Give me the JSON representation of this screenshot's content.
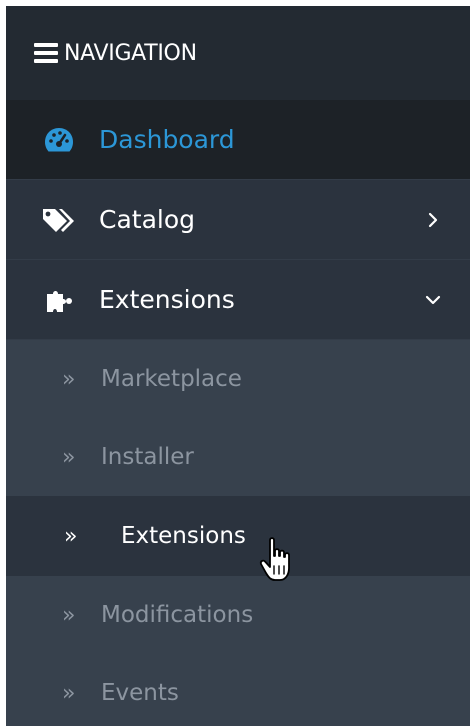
{
  "header": {
    "title": "NAVIGATION"
  },
  "menu": [
    {
      "label": "Dashboard",
      "icon": "dashboard-icon",
      "active": true
    },
    {
      "label": "Catalog",
      "icon": "tags-icon",
      "expanded": false
    },
    {
      "label": "Extensions",
      "icon": "puzzle-icon",
      "expanded": true
    }
  ],
  "submenu": [
    {
      "label": "Marketplace",
      "glyph": "»"
    },
    {
      "label": "Installer",
      "glyph": "»"
    },
    {
      "label": "Extensions",
      "glyph": "»",
      "active": true
    },
    {
      "label": "Modifications",
      "glyph": "»"
    },
    {
      "label": "Events",
      "glyph": "»"
    }
  ],
  "colors": {
    "header_bg": "#232a32",
    "sidebar_bg": "#2b333e",
    "submenu_bg": "#37414d",
    "accent": "#2c97d7",
    "muted_text": "#8c95a0"
  }
}
